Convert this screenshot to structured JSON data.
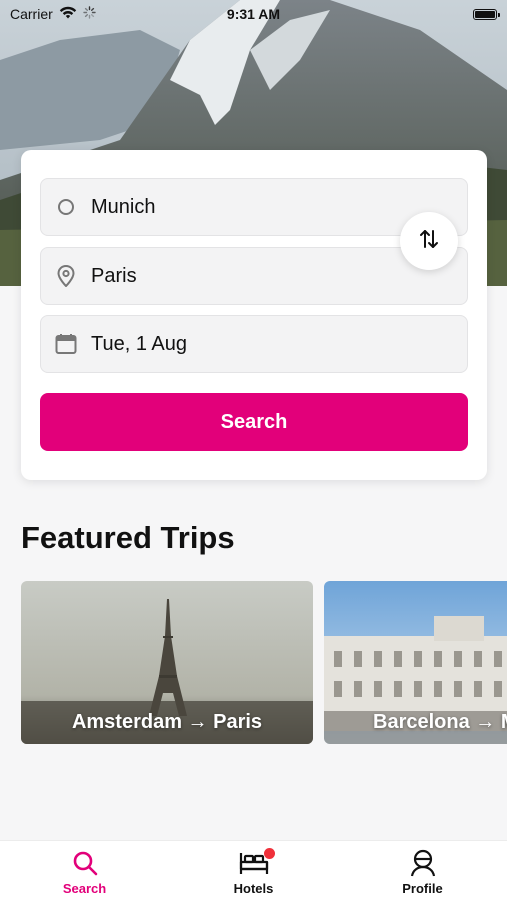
{
  "status_bar": {
    "carrier": "Carrier",
    "time": "9:31 AM"
  },
  "search": {
    "from": "Munich",
    "to": "Paris",
    "date": "Tue, 1 Aug",
    "button_label": "Search"
  },
  "featured": {
    "title": "Featured Trips",
    "trips": [
      {
        "label": "Amsterdam → Paris"
      },
      {
        "label": "Barcelona → M"
      }
    ]
  },
  "tab_bar": {
    "tabs": [
      {
        "label": "Search",
        "active": true
      },
      {
        "label": "Hotels",
        "badge": true
      },
      {
        "label": "Profile"
      }
    ]
  },
  "colors": {
    "accent": "#e2007a",
    "badge": "#f0303a"
  },
  "icons": [
    "wifi-icon",
    "loading-icon",
    "battery-icon",
    "origin-circle-icon",
    "location-pin-icon",
    "calendar-icon",
    "swap-icon",
    "search-icon",
    "bed-icon",
    "profile-icon"
  ]
}
